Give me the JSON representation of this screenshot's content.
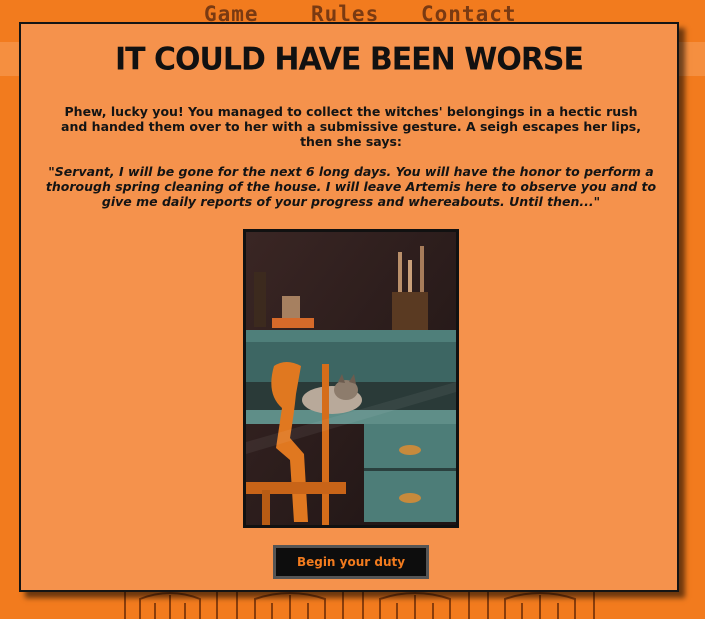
{
  "nav": {
    "items": [
      {
        "label": "Game"
      },
      {
        "label": "Rules"
      },
      {
        "label": "Contact"
      }
    ]
  },
  "modal": {
    "title": "It could have been worse",
    "intro": "Phew, lucky you! You managed to collect the witches' belongings in a hectic rush and handed them over to her with a submissive gesture. A seigh escapes her lips, then she says:",
    "quote": "\"Servant, I will be gone for the next 6 long days. You will have the honor to perform a thorough spring cleaning of the house. I will leave Artemis here to observe you and to give me daily reports of your progress and whereabouts. Until then...\"",
    "button_label": "Begin your duty"
  },
  "colors": {
    "page_background": "#f27b1e",
    "modal_background": "#f5924c",
    "button_text": "#f27b1e"
  }
}
